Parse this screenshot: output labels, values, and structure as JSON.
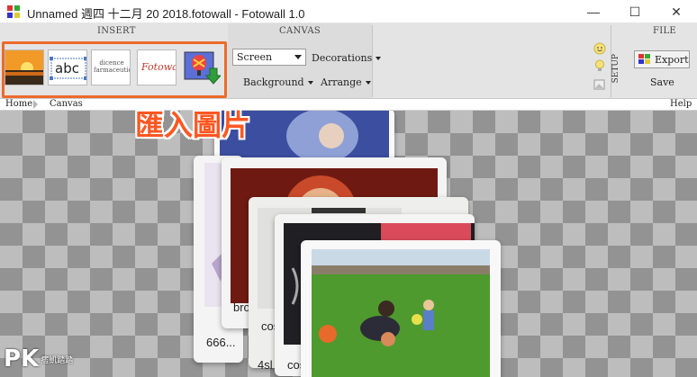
{
  "window": {
    "title": "Unnamed 週四 十二月 20 2018.fotowall - Fotowall 1.0",
    "minimize": "—",
    "maximize": "☐",
    "close": "✕"
  },
  "ribbon": {
    "insert_label": "INSERT",
    "canvas_label": "CANVAS",
    "file_label": "FILE",
    "setup_label": "SETUP",
    "insert_buttons": [
      {
        "name": "picture",
        "tooltip": ""
      },
      {
        "name": "text",
        "text": "abc"
      },
      {
        "name": "word-cloud",
        "text": "dicence farmaceutica"
      },
      {
        "name": "webcam-text",
        "text": "Fotowall"
      },
      {
        "name": "import-picture",
        "text": ""
      }
    ],
    "canvas": {
      "mode_select": "Screen",
      "decorations": "Decorations",
      "background": "Background",
      "arrange": "Arrange"
    },
    "file": {
      "export": "Export",
      "save": "Save"
    }
  },
  "breadcrumb": {
    "home": "Home",
    "canvas": "Canvas",
    "help": "Help"
  },
  "canvas": {
    "captions": {
      "photo2": "666...",
      "photo3": "bro",
      "photo4": "cos",
      "photo5": "cos",
      "photo4b": "4sl"
    }
  },
  "annotation": {
    "text": "匯入圖片"
  },
  "watermark": {
    "mark": "PK",
    "text": "痞凱踏踏"
  },
  "colors": {
    "highlight": "#ee6a2a",
    "annotation": "#ff5722"
  }
}
